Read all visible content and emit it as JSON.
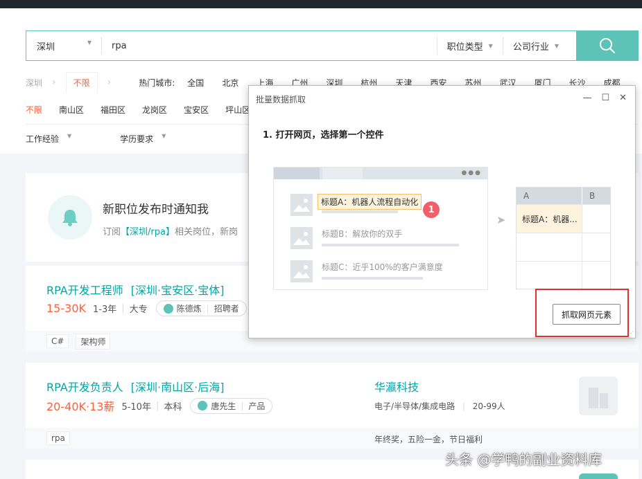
{
  "search": {
    "city": "深圳",
    "query": "rpa",
    "job_type": "职位类型",
    "industry": "公司行业"
  },
  "city_row": {
    "current": "深圳",
    "unlimited": "不限",
    "hot_label": "热门城市:",
    "cities": [
      "全国",
      "北京",
      "上海",
      "广州",
      "深圳",
      "杭州",
      "天津",
      "西安",
      "苏州",
      "武汉",
      "厦门",
      "长沙",
      "成都"
    ]
  },
  "districts": [
    "不限",
    "南山区",
    "福田区",
    "龙岗区",
    "宝安区",
    "坪山区"
  ],
  "filters": [
    "工作经验",
    "学历要求"
  ],
  "notify": {
    "title": "新职位发布时通知我",
    "sub_prefix": "订阅",
    "sub_highlight": "【深圳/rpa】",
    "sub_suffix": "相关岗位，新岗"
  },
  "jobs": [
    {
      "title": "RPA开发工程师",
      "location": "[深圳·宝安区·宝体]",
      "salary": "15-30K",
      "experience": "1-3年",
      "education": "大专",
      "recruiter": "陈德炼",
      "recruiter_role": "招聘者",
      "tags": [
        "C#",
        "架构师"
      ]
    },
    {
      "title": "RPA开发负责人",
      "location": "[深圳·南山区·后海]",
      "salary": "20-40K·13薪",
      "experience": "5-10年",
      "education": "本科",
      "recruiter": "唐先生",
      "recruiter_role": "产品",
      "tags": [
        "rpa"
      ],
      "company": "华瀛科技",
      "company_info": "电子/半导体/集成电路",
      "company_size": "20-99人",
      "benefits": "年终奖，五险一金，节日福利"
    }
  ],
  "modal": {
    "title": "批量数据抓取",
    "step": "1. 打开网页，选择第一个控件",
    "item_a": "标题A：机器人流程自动化",
    "item_b": "标题B：解放你的双手",
    "item_c": "标题C：近乎100%的客户满意度",
    "badge": "1",
    "col_a": "A",
    "col_b": "B",
    "cell": "标题A：机器...",
    "grab_button": "抓取网页元素",
    "controls": {
      "minimize": "—",
      "maximize": "☐",
      "close": "✕"
    }
  },
  "watermark": "头条 @学鸭的副业资料库"
}
